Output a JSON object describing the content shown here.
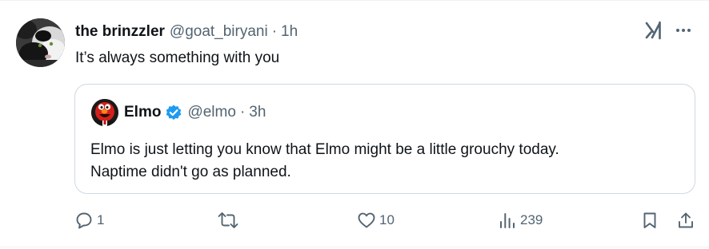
{
  "tweet": {
    "display_name": "the brinzzler",
    "handle": "@goat_biryani",
    "separator": "·",
    "time": "1h",
    "text": "It’s always something with you",
    "avatar_icon": "cat-avatar"
  },
  "header_actions": {
    "grok_icon": "grok-icon",
    "more_icon": "more-icon"
  },
  "quoted_tweet": {
    "display_name": "Elmo",
    "verified_icon": "verified-badge-icon",
    "verified_color": "#1d9bf0",
    "handle": "@elmo",
    "separator": "·",
    "time": "3h",
    "text_lines": [
      "Elmo is just letting you know that Elmo might be a little grouchy today.",
      "Naptime didn't go as planned."
    ],
    "avatar_icon": "elmo-avatar"
  },
  "actions": {
    "reply_count": "1",
    "retweet_count": "",
    "like_count": "10",
    "views_count": "239"
  },
  "colors": {
    "text_primary": "#0f1419",
    "text_secondary": "#536471",
    "border": "#cfd9de",
    "accent": "#1d9bf0"
  }
}
